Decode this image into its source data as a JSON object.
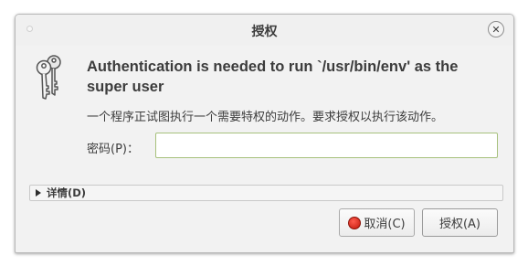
{
  "dialog": {
    "title": "授权",
    "close_glyph": "✕",
    "heading": "Authentication is needed to run `/usr/bin/env' as the super user",
    "description": "一个程序正试图执行一个需要特权的动作。要求授权以执行该动作。",
    "password_label": "密码(P)：",
    "password_value": "",
    "details_label": "详情(D)",
    "cancel_label": "取消(C)",
    "authenticate_label": "授权(A)",
    "icons": {
      "dialog_icon": "keys-icon",
      "cancel_icon": "stop-icon",
      "details_icon": "triangle-right-icon"
    },
    "colors": {
      "input_focus_border": "#a7c17c",
      "cancel_icon_red": "#e0281a"
    }
  }
}
